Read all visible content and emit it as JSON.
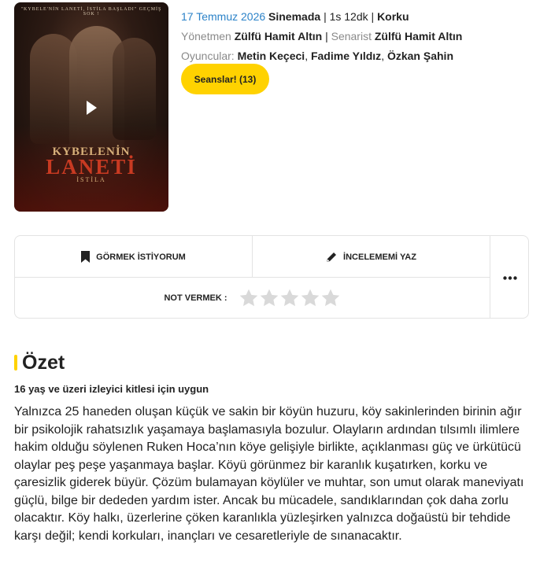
{
  "poster": {
    "tagline": "\"KYBELE'NİN LANETİ, İSTİLA BAŞLADI\" GEÇMİŞ SOK !",
    "title_line1": "KYBELENİN",
    "title_line2": "LANETİ",
    "title_line3": "İSTİLA"
  },
  "info": {
    "date": "17 Temmuz 2026",
    "status": "Sinemada",
    "duration": "1s 12dk",
    "genre": "Korku",
    "director_label": "Yönetmen",
    "director": "Zülfü Hamit Altın",
    "writer_label": "Senarist",
    "writer": "Zülfü Hamit Altın",
    "cast_label": "Oyuncular:",
    "cast": [
      "Metin Keçeci",
      "Fadime Yıldız",
      "Özkan Şahin"
    ]
  },
  "seanslar_label": "Seanslar! (13)",
  "actions": {
    "want": "GÖRMEK İSTİYORUM",
    "review": "İNCELEMEMİ YAZ",
    "rate_label": "NOT VERMEK :",
    "star_count": 5,
    "rating_value": 0
  },
  "summary": {
    "heading": "Özet",
    "age_notice": "16 yaş ve üzeri izleyici kitlesi için uygun",
    "text": "Yalnızca 25 haneden oluşan küçük ve sakin bir köyün huzuru, köy sakinlerinden birinin ağır bir psikolojik rahatsızlık yaşamaya başlamasıyla bozulur. Olayların ardından tılsımlı ilimlere hakim olduğu söylenen Ruken Hoca’nın köye gelişiyle birlikte, açıklanması güç ve ürkütücü olaylar peş peşe yaşanmaya başlar. Köyü görünmez bir karanlık kuşatırken, korku ve çaresizlik giderek büyür. Çözüm bulamayan köylüler ve muhtar, son umut olarak maneviyatı güçlü, bilge bir dededen yardım ister. Ancak bu mücadele, sandıklarından çok daha zorlu olacaktır. Köy halkı, üzerlerine çöken karanlıkla yüzleşirken yalnızca doğaüstü bir tehdide karşı değil; kendi korkuları, inançları ve cesaretleriyle de sınanacaktır."
  },
  "colors": {
    "accent_yellow": "#ffd200",
    "link_blue": "#2b82c8",
    "star_gray": "#d9d9d9"
  }
}
